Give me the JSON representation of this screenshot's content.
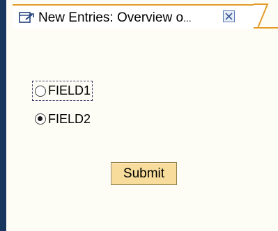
{
  "tab": {
    "title": "New Entries: Overview o",
    "ellipsis": "...",
    "icon": "edit-document-icon",
    "close_icon": "close-icon"
  },
  "form": {
    "options": [
      {
        "label": "FIELD1",
        "selected": false
      },
      {
        "label": "FIELD2",
        "selected": true
      }
    ],
    "submit_label": "Submit"
  },
  "colors": {
    "accent_orange": "#e39b26",
    "frame_navy": "#17375e",
    "button_bg": "#f7dc9b",
    "background": "#fdfdf5"
  }
}
